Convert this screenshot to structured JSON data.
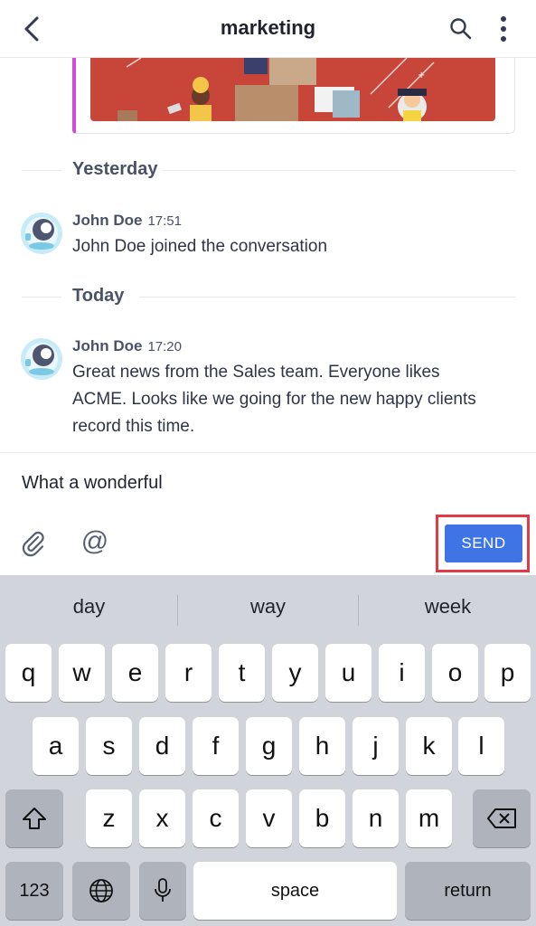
{
  "header": {
    "title": "marketing",
    "back_icon": "chevron-left-icon",
    "search_icon": "search-icon",
    "menu_icon": "more-vertical-icon"
  },
  "attachment": {
    "accent_color": "#d24bd8",
    "image_bg": "#c8453a"
  },
  "dividers": [
    {
      "label": "Yesterday"
    },
    {
      "label": "Today"
    }
  ],
  "messages": [
    {
      "author": "John Doe",
      "time": "17:51",
      "text": "John Doe joined the conversation"
    },
    {
      "author": "John Doe",
      "time": "17:20",
      "text": "Great news from the Sales team. Everyone likes ACME. Looks like we going for the new happy clients record this time."
    }
  ],
  "composer": {
    "value": "What a wonderful",
    "attach_icon": "paperclip-icon",
    "mention_label": "@",
    "send_label": "SEND",
    "send_color": "#3f74e6",
    "highlight_color": "#e23b46"
  },
  "keyboard": {
    "suggestions": [
      "day",
      "way",
      "week"
    ],
    "row1": [
      "q",
      "w",
      "e",
      "r",
      "t",
      "y",
      "u",
      "i",
      "o",
      "p"
    ],
    "row2": [
      "a",
      "s",
      "d",
      "f",
      "g",
      "h",
      "j",
      "k",
      "l"
    ],
    "row3": [
      "z",
      "x",
      "c",
      "v",
      "b",
      "n",
      "m"
    ],
    "numbers_label": "123",
    "space_label": "space",
    "return_label": "return",
    "shift_icon": "shift-icon",
    "delete_icon": "backspace-icon",
    "globe_icon": "globe-icon",
    "mic_icon": "microphone-icon"
  }
}
